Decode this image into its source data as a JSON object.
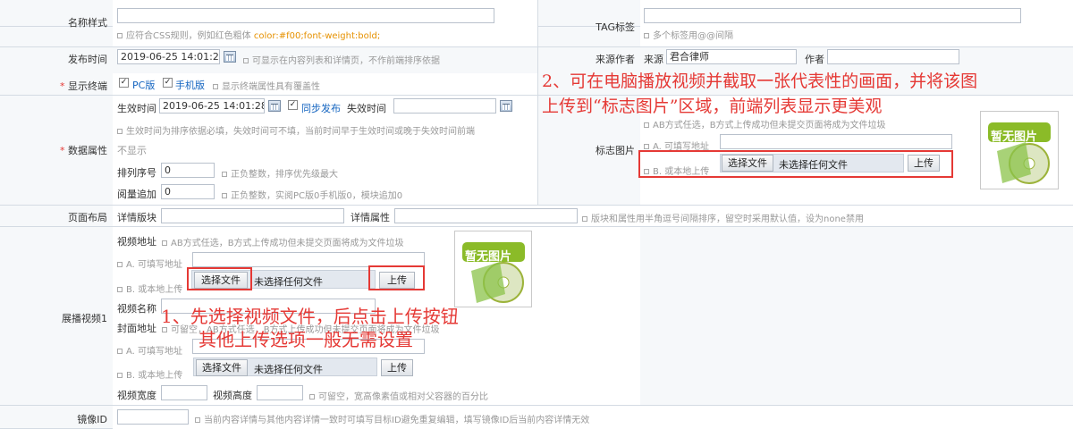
{
  "name_style": {
    "label": "名称样式",
    "hint": "应符合CSS规则，例如红色粗体",
    "hint_code": "color:#f00;font-weight:bold;"
  },
  "tag": {
    "label": "TAG标签",
    "hint": "多个标签用@@间隔"
  },
  "publish_time": {
    "label": "发布时间",
    "value": "2019-06-25 14:01:28",
    "hint": "可显示在内容列表和详情页，不作前端排序依据"
  },
  "source": {
    "label": "来源作者",
    "source_label": "来源",
    "source_value": "君合律师",
    "author_label": "作者",
    "author_value": ""
  },
  "display_terminal": {
    "label": "显示终端",
    "opt1": "PC版",
    "opt2": "手机版",
    "hint": "显示终端属性具有覆盖性"
  },
  "data_attr": {
    "label": "数据属性",
    "not_show": "不显示",
    "effective_label": "生效时间",
    "effective_value": "2019-06-25 14:01:28",
    "sync_label": "同步发布",
    "expire_label": "失效时间",
    "time_hint": "生效时间为排序依据必填，失效时间可不填，当前时间早于生效时间或晚于失效时间前端",
    "sort_label": "排列序号",
    "sort_value": "0",
    "sort_hint": "正负整数，排序优先级最大",
    "read_label": "阅量追加",
    "read_value": "0",
    "read_hint": "正负整数，实阅PC版0手机版0，模块追加0"
  },
  "logo_image": {
    "label": "标志图片",
    "hint_ab": "AB方式任选，B方式上传成功但未提交页面将成为文件垃圾",
    "a_label": "A. 可填写地址",
    "b_label": "B. 或本地上传",
    "choose_btn": "选择文件",
    "no_file": "未选择任何文件",
    "upload_btn": "上传",
    "placeholder_text": "暂无图片"
  },
  "layout": {
    "label": "页面布局",
    "block_label": "详情版块",
    "attr_label": "详情属性",
    "hint": "版块和属性用半角逗号间隔排序，留空时采用默认值，设为none禁用"
  },
  "video": {
    "label": "展播视频1",
    "addr_label": "视频地址",
    "addr_hint": "AB方式任选，B方式上传成功但未提交页面将成为文件垃圾",
    "a_label": "A. 可填写地址",
    "b_label": "B. 或本地上传",
    "choose_btn": "选择文件",
    "no_file": "未选择任何文件",
    "upload_btn": "上传",
    "name_label": "视频名称",
    "cover_label": "封面地址",
    "cover_hint": "可留空，AB方式任选，B方式上传成功但未提交页面将成为文件垃圾",
    "cover_a_label": "A. 可填写地址",
    "cover_b_label": "B. 或本地上传",
    "cover_choose_btn": "选择文件",
    "cover_no_file": "未选择任何文件",
    "cover_upload_btn": "上传",
    "width_label": "视频宽度",
    "height_label": "视频高度",
    "size_hint": "可留空，宽高像素值或相对父容器的百分比",
    "placeholder_text": "暂无图片"
  },
  "mirror": {
    "label": "镜像ID",
    "hint": "当前内容详情与其他内容详情一致时可填写目标ID避免重复编辑，填写镜像ID后当前内容详情无效"
  },
  "annotations": {
    "note1_line1": "1、先选择视频文件，后点击上传按钮",
    "note1_line2": "其他上传选项一般无需设置",
    "note2_line1": "2、可在电脑播放视频并截取一张代表性的画面，并将该图",
    "note2_line2": "上传到“标志图片”区域，前端列表显示更美观"
  },
  "colors": {
    "annotation": "#e53935",
    "link": "#1565c0",
    "hint": "#999999"
  }
}
